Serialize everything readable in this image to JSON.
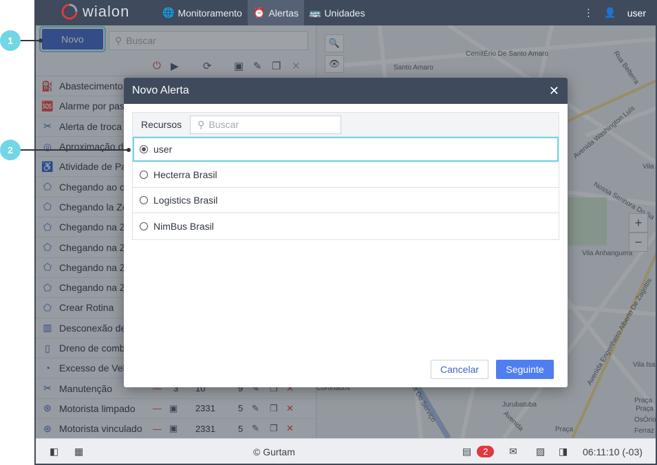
{
  "app": {
    "logo": "wialon",
    "nav": [
      {
        "label": "Monitoramento",
        "icon": "globe-icon"
      },
      {
        "label": "Alertas",
        "icon": "alarm-clock-icon"
      },
      {
        "label": "Unidades",
        "icon": "bus-icon"
      }
    ],
    "user": "user",
    "colors": {
      "topbar": "#3f4a5c",
      "accent": "#3e63c6",
      "highlight": "#71d6e6",
      "danger": "#e0393e"
    }
  },
  "left_panel": {
    "new_button": "Novo",
    "search_placeholder": "Buscar",
    "items": [
      {
        "name": "Abastecimento",
        "icon": "fuel-icon"
      },
      {
        "name": "Alarme por pas",
        "icon": "sos-icon"
      },
      {
        "name": "Alerta de troca",
        "icon": "tools-icon"
      },
      {
        "name": "Aproximação d",
        "icon": "sensor-icon"
      },
      {
        "name": "Atividade de Pa",
        "icon": "seat-icon"
      },
      {
        "name": "Chegando ao c",
        "icon": "geofence-icon"
      },
      {
        "name": "Chegando la Zo",
        "icon": "geofence-icon"
      },
      {
        "name": "Chegando na Z",
        "icon": "geofence-icon"
      },
      {
        "name": "Chegando na Z",
        "icon": "geofence-icon"
      },
      {
        "name": "Chegando na Z",
        "icon": "geofence-icon"
      },
      {
        "name": "Chegando na Z",
        "icon": "geofence-icon"
      },
      {
        "name": "Crear Rotina",
        "icon": "route-icon"
      },
      {
        "name": "Desconexão de",
        "icon": "chart-icon"
      },
      {
        "name": "Dreno de comb",
        "icon": "fuel-drain-icon"
      },
      {
        "name": "Excesso de Vel",
        "icon": "speed-icon"
      },
      {
        "name": "Manutenção",
        "icon": "tools-icon",
        "a": "3",
        "b": "10",
        "c": "9"
      },
      {
        "name": "Motorista limpado",
        "icon": "steering-wheel-icon",
        "b": "2331",
        "c": "5"
      },
      {
        "name": "Motorista vinculado",
        "icon": "steering-wheel-icon",
        "b": "2331",
        "c": "5"
      }
    ]
  },
  "map_labels": [
    "CemitÉrio De Santo Amaro",
    "Santo Amaro",
    "Rua Belterra",
    "Avenida Washington Luís",
    "Vila S",
    "Nossa Senhora Do Sa",
    "Vila Anhanguera",
    "Avenida Engenheiro Alberto De Zagottis",
    "Vila Isa",
    "Coronados",
    "Jurubatuba",
    "Praça",
    "Rua Do Serviço",
    "Avenida",
    "Praça",
    "Ferraz",
    "Praça José",
    "OsÓrio"
  ],
  "dialog": {
    "title": "Novo Alerta",
    "resources_label": "Recursos",
    "search_placeholder": "Buscar",
    "resources": [
      "user",
      "Hecterra Brasil",
      "Logistics Brasil",
      "NimBus Brasil"
    ],
    "selected": "user",
    "cancel": "Cancelar",
    "next": "Seguinte"
  },
  "callouts": [
    "1",
    "2"
  ],
  "bottom": {
    "copyright": "© Gurtam",
    "notifications": "2",
    "time": "06:11:10 (-03)"
  }
}
